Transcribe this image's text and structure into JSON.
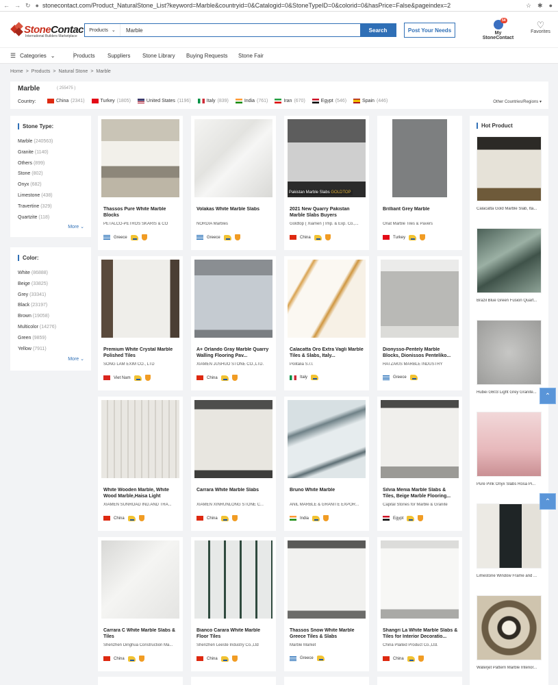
{
  "browser": {
    "url": "stonecontact.com/Product_NaturalStone_List?keyword=Marble&countryid=0&Catalogid=0&StoneTypeID=0&colorid=0&hasPrice=False&pageindex=2"
  },
  "header": {
    "logo_name_a": "Stone",
    "logo_name_b": "Contact",
    "logo_tag": "International Builders Marketplace",
    "search_category": "Products",
    "search_value": "Marble",
    "search_button": "Search",
    "post_needs": "Post Your Needs",
    "my_account": "My StoneContact",
    "badge": "54",
    "favorites": "Favorites"
  },
  "menu": {
    "categories": "Categories",
    "items": [
      "Products",
      "Suppliers",
      "Stone Library",
      "Buying Requests",
      "Stone Fair"
    ]
  },
  "breadcrumb": [
    "Home",
    ">",
    "Products",
    ">",
    "Natural Stone",
    ">",
    "Marble"
  ],
  "summary": {
    "title": "Marble",
    "count": "( 255475 )",
    "country_label": "Country:",
    "other": "Other Countries/Regions",
    "countries": [
      {
        "name": "China",
        "count": "(2341)"
      },
      {
        "name": "Turkey",
        "count": "(1805)"
      },
      {
        "name": "United States",
        "count": "(1196)"
      },
      {
        "name": "Italy",
        "count": "(839)"
      },
      {
        "name": "India",
        "count": "(761)"
      },
      {
        "name": "Iran",
        "count": "(670)"
      },
      {
        "name": "Egypt",
        "count": "(546)"
      },
      {
        "name": "Spain",
        "count": "(446)"
      }
    ]
  },
  "stone_type": {
    "heading": "Stone Type:",
    "more": "More",
    "items": [
      {
        "name": "Marble",
        "count": "(240563)"
      },
      {
        "name": "Granite",
        "count": "(1140)"
      },
      {
        "name": "Others",
        "count": "(899)"
      },
      {
        "name": "Stone",
        "count": "(802)"
      },
      {
        "name": "Onyx",
        "count": "(682)"
      },
      {
        "name": "Limestone",
        "count": "(438)"
      },
      {
        "name": "Travertine",
        "count": "(329)"
      },
      {
        "name": "Quartzite",
        "count": "(118)"
      }
    ]
  },
  "color": {
    "heading": "Color:",
    "more": "More",
    "items": [
      {
        "name": "White",
        "count": "(86888)"
      },
      {
        "name": "Beige",
        "count": "(33825)"
      },
      {
        "name": "Grey",
        "count": "(33341)"
      },
      {
        "name": "Black",
        "count": "(23197)"
      },
      {
        "name": "Brown",
        "count": "(19058)"
      },
      {
        "name": "Multicolor",
        "count": "(14276)"
      },
      {
        "name": "Green",
        "count": "(9859)"
      },
      {
        "name": "Yellow",
        "count": "(7911)"
      }
    ]
  },
  "products": [
    {
      "title": "Thassos Pure White Marble Blocks",
      "company": "PETALCO-PETROS SKARIS & CO",
      "country": "Greece"
    },
    {
      "title": "Volakas White Marble Slabs",
      "company": "NORDIA Marbles",
      "country": "Greece"
    },
    {
      "title": "2021 New Quarry Pakistan Marble Slabs Buyers",
      "company": "Goldtop ( Xiamen ) Imp. & Exp. Co.,...",
      "country": "China",
      "img_text": "Pakistan Marble Slabs",
      "img_brand": "GOLDTOP"
    },
    {
      "title": "Brilliant Grey Marble",
      "company": "Onat Marble Tiles & Pavers",
      "country": "Turkey"
    },
    {
      "title": "Premium White Crystal Marble Polished Tiles",
      "company": "SONG LAM EXIM CO., LTD",
      "country": "Viet Nam"
    },
    {
      "title": "A+ Orlando Gray Marble Quarry Walling Flooring Pav...",
      "company": "XIAMEN JUSHUO STONE CO.,LTD.",
      "country": "China"
    },
    {
      "title": "Calacatta Oro Extra Vagli Marble Tiles & Slabs, Italy...",
      "company": "Politalia S.r.l.",
      "country": "Italy"
    },
    {
      "title": "Dionysso-Pentely Marble Blocks, Dionissos Penteliko...",
      "company": "HATZAKIS MARBLE INDUSTRY",
      "country": "Greece"
    },
    {
      "title": "White Wooden Marble, White Wood Marble,Haisa Light",
      "company": "XIAMEN SUNROAD IND.AND TRA...",
      "country": "China"
    },
    {
      "title": "Carrara White Marble Slabs",
      "company": "XIAMEN XINRUNLONG STONE C...",
      "country": "China"
    },
    {
      "title": "Bruno White Marble",
      "company": "ANIL MARBLE & GRANITE EXPOR...",
      "country": "India"
    },
    {
      "title": "Silvia Menia Marble Slabs & Tiles, Beige Marble Flooring...",
      "company": "Capital Stones for Marble & Granite",
      "country": "Egypt"
    },
    {
      "title": "Carrara C White Marble Slabs & Tiles",
      "company": "Shenzhen Dinghua Construction Ma...",
      "country": "China"
    },
    {
      "title": "Bianco Carara White Marble Floor Tiles",
      "company": "Shenzhen Leeste Industry Co.,Ltd",
      "country": "China"
    },
    {
      "title": "Thassos Snow White Marble Greece Tiles & Slabs",
      "company": "Marble Market",
      "country": "Greece"
    },
    {
      "title": "Shangri La White Marble Slabs & Tiles for Interior Decoratio...",
      "company": "China Plaited Product Co.,Ltd.",
      "country": "China"
    }
  ],
  "hot": {
    "heading": "Hot Product",
    "items": [
      {
        "caption": "Calacatta Gold Marble Slab, Ita..."
      },
      {
        "caption": "Brazil Blue Green Fusion Quart..."
      },
      {
        "caption": "Hubei G603 Light Grey Granite..."
      },
      {
        "caption": "Pure Pink Onyx Slabs Rosa Pi..."
      },
      {
        "caption": "Limestone Window Frame and ..."
      },
      {
        "caption": "Waterjet Pattern Marble Interior..."
      }
    ]
  },
  "colors": {
    "accent": "#2f6fb6",
    "brand_red": "#c8311f",
    "badge": "#e8432e"
  }
}
